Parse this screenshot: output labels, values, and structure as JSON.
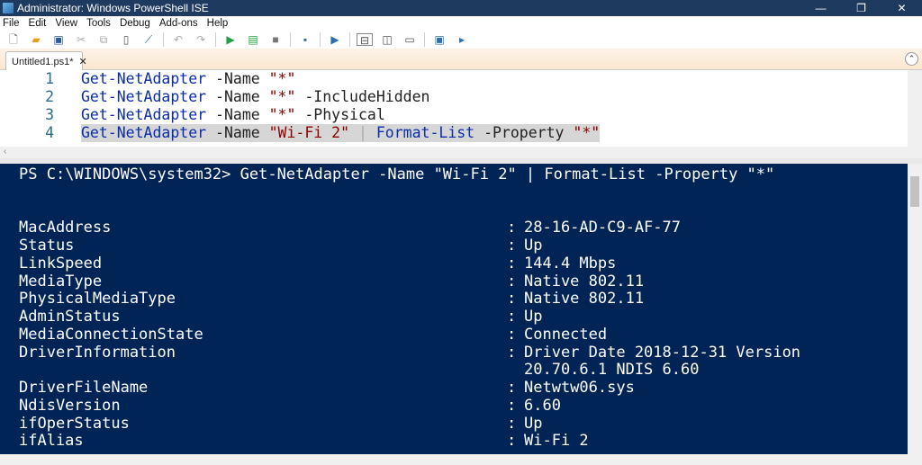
{
  "window": {
    "title": "Administrator: Windows PowerShell ISE"
  },
  "menu": [
    "File",
    "Edit",
    "View",
    "Tools",
    "Debug",
    "Add-ons",
    "Help"
  ],
  "tab": {
    "label": "Untitled1.ps1*",
    "close": "✕"
  },
  "editor": {
    "lines": [
      {
        "num": "1",
        "cmd": "Get-NetAdapter",
        "par": "-Name",
        "str": "\"*\"",
        "rest": ""
      },
      {
        "num": "2",
        "cmd": "Get-NetAdapter",
        "par": "-Name",
        "str": "\"*\"",
        "rest": "-IncludeHidden"
      },
      {
        "num": "3",
        "cmd": "Get-NetAdapter",
        "par": "-Name",
        "str": "\"*\"",
        "rest": "-Physical"
      },
      {
        "num": "4",
        "cmd": "Get-NetAdapter",
        "par": "-Name",
        "str": "\"Wi-Fi 2\"",
        "pipe": "|",
        "cmd2": "Format-List",
        "par2": "-Property",
        "str2": "\"*\""
      }
    ]
  },
  "console": {
    "prompt": "PS C:\\WINDOWS\\system32> Get-NetAdapter -Name \"Wi-Fi 2\" | Format-List -Property \"*\"",
    "rows": [
      {
        "k": "MacAddress",
        "v": "28-16-AD-C9-AF-77"
      },
      {
        "k": "Status",
        "v": "Up"
      },
      {
        "k": "LinkSpeed",
        "v": "144.4 Mbps"
      },
      {
        "k": "MediaType",
        "v": "Native 802.11"
      },
      {
        "k": "PhysicalMediaType",
        "v": "Native 802.11"
      },
      {
        "k": "AdminStatus",
        "v": "Up"
      },
      {
        "k": "MediaConnectionState",
        "v": "Connected"
      },
      {
        "k": "DriverInformation",
        "v": "Driver Date 2018-12-31 Version"
      },
      {
        "k": "",
        "v": "20.70.6.1 NDIS 6.60",
        "cont": true
      },
      {
        "k": "DriverFileName",
        "v": "Netwtw06.sys"
      },
      {
        "k": "NdisVersion",
        "v": "6.60"
      },
      {
        "k": "ifOperStatus",
        "v": "Up"
      },
      {
        "k": "ifAlias",
        "v": "Wi-Fi 2"
      }
    ]
  }
}
